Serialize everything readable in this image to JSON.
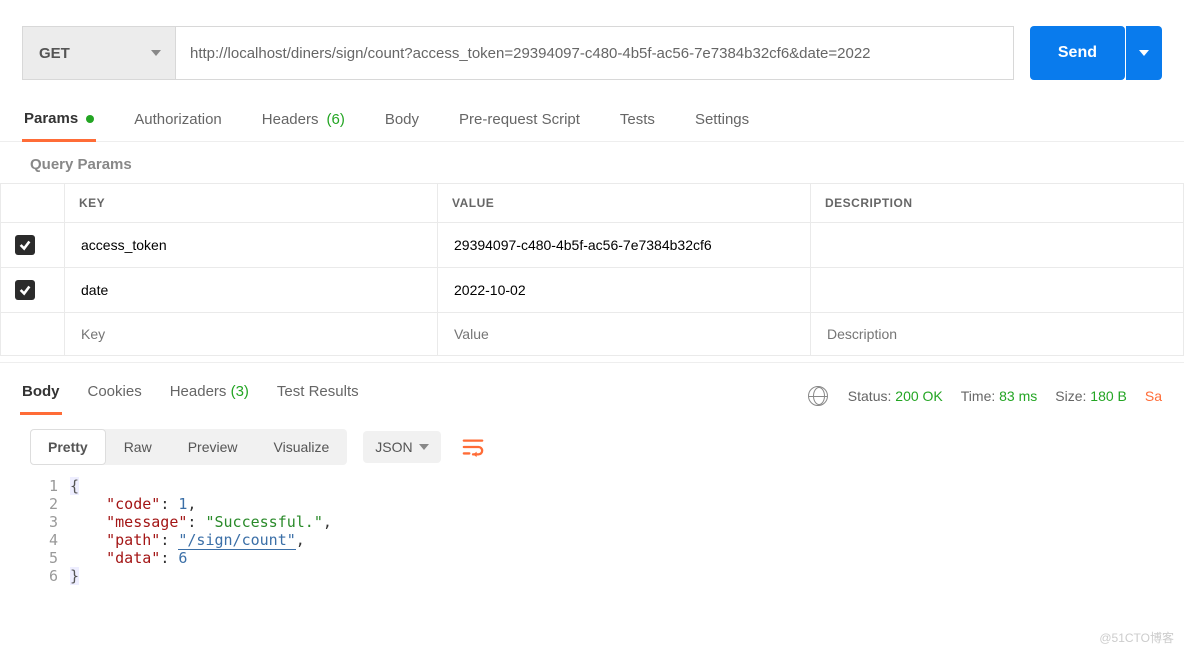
{
  "request": {
    "method": "GET",
    "url": "http://localhost/diners/sign/count?access_token=29394097-c480-4b5f-ac56-7e7384b32cf6&date=2022",
    "send_label": "Send"
  },
  "req_tabs": {
    "params": "Params",
    "authorization": "Authorization",
    "headers": "Headers",
    "headers_count": "(6)",
    "body": "Body",
    "pre_request": "Pre-request Script",
    "tests": "Tests",
    "settings": "Settings"
  },
  "query_params": {
    "title": "Query Params",
    "headers": {
      "key": "KEY",
      "value": "VALUE",
      "description": "DESCRIPTION"
    },
    "rows": [
      {
        "checked": true,
        "key": "access_token",
        "value": "29394097-c480-4b5f-ac56-7e7384b32cf6",
        "description": ""
      },
      {
        "checked": true,
        "key": "date",
        "value": "2022-10-02",
        "description": ""
      }
    ],
    "placeholders": {
      "key": "Key",
      "value": "Value",
      "description": "Description"
    }
  },
  "response": {
    "tabs": {
      "body": "Body",
      "cookies": "Cookies",
      "headers": "Headers",
      "headers_count": "(3)",
      "test_results": "Test Results"
    },
    "status_label": "Status:",
    "status_value": "200 OK",
    "time_label": "Time:",
    "time_value": "83 ms",
    "size_label": "Size:",
    "size_value": "180 B",
    "save_label": "Sa"
  },
  "view": {
    "pretty": "Pretty",
    "raw": "Raw",
    "preview": "Preview",
    "visualize": "Visualize",
    "format": "JSON"
  },
  "body_json": {
    "lines": [
      "1",
      "2",
      "3",
      "4",
      "5",
      "6"
    ],
    "k_code": "\"code\"",
    "v_code": "1",
    "k_message": "\"message\"",
    "v_message": "\"Successful.\"",
    "k_path": "\"path\"",
    "v_path": "\"/sign/count\"",
    "k_data": "\"data\"",
    "v_data": "6",
    "open": "{",
    "close": "}",
    "colon": ": ",
    "comma": ","
  },
  "watermark": "@51CTO博客"
}
